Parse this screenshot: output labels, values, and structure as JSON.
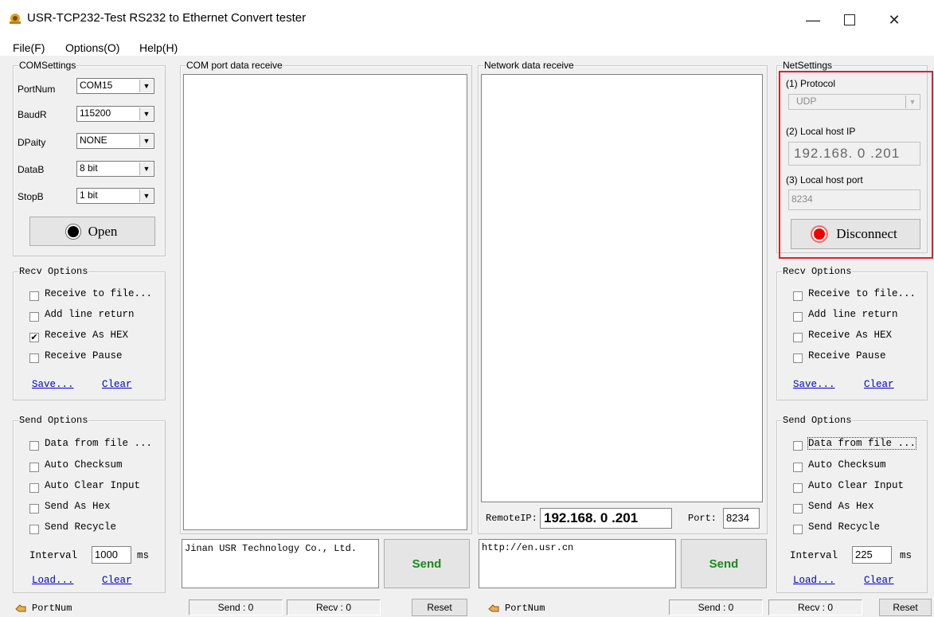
{
  "window": {
    "title": "USR-TCP232-Test  RS232 to Ethernet Convert tester",
    "minimize_icon": "minimize-icon",
    "maximize_icon": "maximize-icon",
    "close_icon": "close-icon"
  },
  "menu": {
    "file": "File(F)",
    "options": "Options(O)",
    "help": "Help(H)"
  },
  "com_settings": {
    "legend": "COMSettings",
    "port_label": "PortNum",
    "port_value": "COM15",
    "baud_label": "BaudR",
    "baud_value": "115200",
    "parity_label": "DPaity",
    "parity_value": "NONE",
    "data_label": "DataB",
    "data_value": "8 bit",
    "stop_label": "StopB",
    "stop_value": "1 bit",
    "open_label": "Open"
  },
  "left_recv": {
    "legend": "Recv Options",
    "receive_to_file": "Receive to file...",
    "add_line_return": "Add line return",
    "receive_as_hex": "Receive As HEX",
    "receive_pause": "Receive Pause",
    "save": "Save...",
    "clear": "Clear"
  },
  "left_send": {
    "legend": "Send Options",
    "data_from_file": "Data from file ...",
    "auto_checksum": "Auto Checksum",
    "auto_clear_input": "Auto Clear Input",
    "send_as_hex": "Send As Hex",
    "send_recycle": "Send Recycle",
    "interval_label": "Interval",
    "interval_value": "1000",
    "interval_unit": "ms",
    "load": "Load...",
    "clear": "Clear"
  },
  "com_receive": {
    "legend": "COM port data receive"
  },
  "net_receive": {
    "legend": "Network data receive"
  },
  "remote": {
    "ip_label": "RemoteIP:",
    "ip_value": "192.168. 0 .201",
    "port_label": "Port:",
    "port_value": "8234"
  },
  "com_send": {
    "text": "Jinan USR Technology Co., Ltd.",
    "button": "Send"
  },
  "net_send": {
    "text": "http://en.usr.cn",
    "button": "Send"
  },
  "net_settings": {
    "legend": "NetSettings",
    "protocol_label": "(1) Protocol",
    "protocol_value": "UDP",
    "local_ip_label": "(2) Local host IP",
    "local_ip_value": "192.168. 0 .201",
    "local_port_label": "(3) Local host port",
    "local_port_value": "8234",
    "disconnect_label": "Disconnect"
  },
  "right_recv": {
    "legend": "Recv Options",
    "receive_to_file": "Receive to file...",
    "add_line_return": "Add line return",
    "receive_as_hex": "Receive As HEX",
    "receive_pause": "Receive Pause",
    "save": "Save...",
    "clear": "Clear"
  },
  "right_send": {
    "legend": "Send Options",
    "data_from_file": "Data from file ...",
    "auto_checksum": "Auto Checksum",
    "auto_clear_input": "Auto Clear Input",
    "send_as_hex": "Send As Hex",
    "send_recycle": "Send Recycle",
    "interval_label": "Interval",
    "interval_value": "225",
    "interval_unit": "ms",
    "load": "Load...",
    "clear": "Clear"
  },
  "status": {
    "left_portnum": "PortNum",
    "left_send": "Send : 0",
    "left_recv": "Recv : 0",
    "left_reset": "Reset",
    "right_portnum": "PortNum",
    "right_send": "Send : 0",
    "right_recv": "Recv : 0",
    "right_reset": "Reset"
  },
  "colors": {
    "highlight_frame": "#e0202a",
    "send_green": "#1a8a1a",
    "link_blue": "#0000cc"
  }
}
